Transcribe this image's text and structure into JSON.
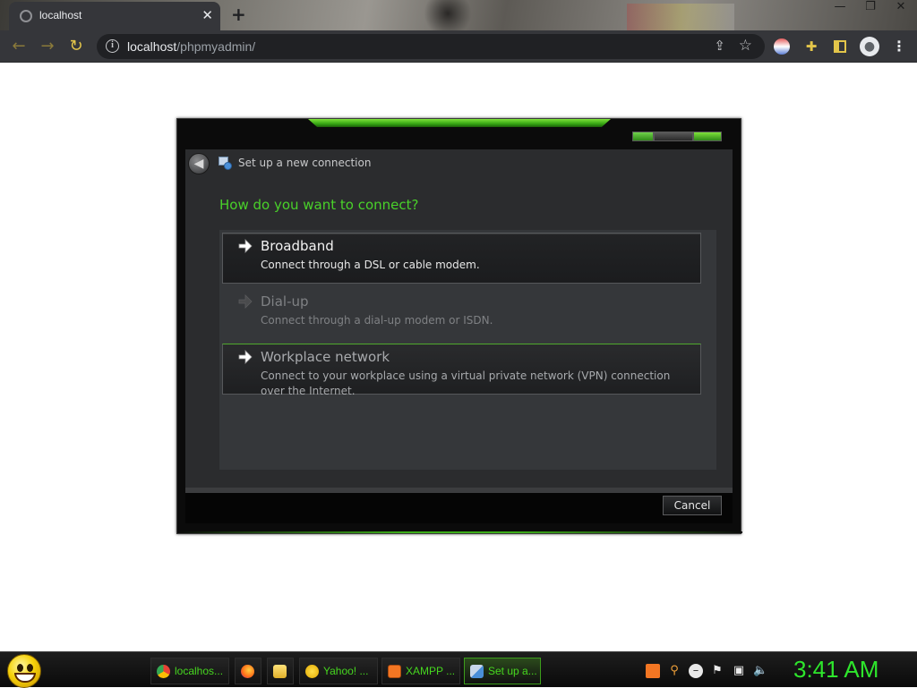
{
  "browser": {
    "tab_title": "localhost",
    "tab_close": "✕",
    "new_tab": "+",
    "window_controls": [
      "—",
      "❐",
      "✕"
    ],
    "url_host": "localhost",
    "url_path": "/phpmyadmin/",
    "icons": [
      "back-icon",
      "forward-icon",
      "reload-icon",
      "info-icon",
      "share-icon",
      "star-icon",
      "profile-ball-icon",
      "puzzle-icon",
      "side-panel-icon",
      "account-icon",
      "menu-icon"
    ]
  },
  "dialog": {
    "title": "Set up a new connection",
    "question": "How do you want to connect?",
    "options": [
      {
        "title": "Broadband",
        "description": "Connect through a DSL or cable modem.",
        "state": "selected"
      },
      {
        "title": "Dial-up",
        "description": "Connect through a dial-up modem or ISDN.",
        "state": "disabled"
      },
      {
        "title": "Workplace network",
        "description": "Connect to your workplace using a virtual private network (VPN) connection over the Internet.",
        "state": "hover"
      }
    ],
    "cancel_label": "Cancel",
    "accent_color": "#49d12a"
  },
  "taskbar": {
    "tasks": [
      {
        "label": "localhos...",
        "icon": "chrome-icon"
      },
      {
        "label": "",
        "icon": "firefox-icon"
      },
      {
        "label": "",
        "icon": "folder-icon"
      },
      {
        "label": "Yahoo! ...",
        "icon": "yahoo-messenger-icon"
      },
      {
        "label": "XAMPP ...",
        "icon": "xampp-icon"
      },
      {
        "label": "Set up a...",
        "icon": "network-setup-icon"
      }
    ],
    "tray_icons": [
      "xampp-tray-icon",
      "search-tray-icon",
      "messenger-tray-icon",
      "action-center-flag-icon",
      "network-icon",
      "volume-icon"
    ],
    "clock": "3:41 AM",
    "clock_color": "#2ee62c"
  }
}
